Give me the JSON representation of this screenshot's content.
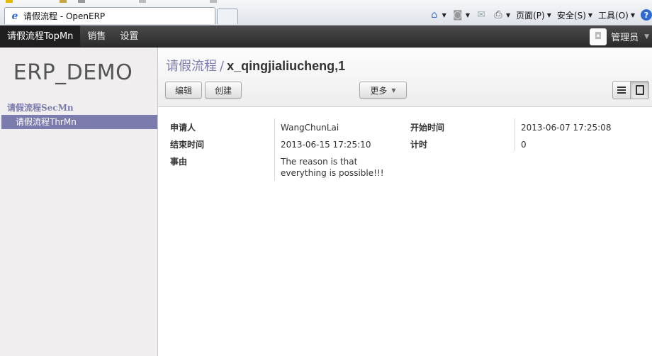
{
  "browser": {
    "tab_title": "请假流程 - OpenERP",
    "tab_icon": "ie-icon",
    "toolbar": {
      "page_label": "页面(P)",
      "safety_label": "安全(S)",
      "tools_label": "工具(O)"
    }
  },
  "topnav": {
    "menu": [
      "请假流程TopMn",
      "销售",
      "设置"
    ],
    "active_index": 0,
    "user_label": "管理员"
  },
  "sidebar": {
    "logo_text": "ERP_DEMO",
    "section_title": "请假流程SecMn",
    "items": [
      {
        "label": "请假流程ThrMn",
        "selected": true
      }
    ]
  },
  "header": {
    "breadcrumb_parent": "请假流程",
    "breadcrumb_separator": "/",
    "breadcrumb_current": "x_qingjialiucheng,1",
    "edit_label": "编辑",
    "create_label": "创建",
    "more_label": "更多"
  },
  "form": {
    "applicant_label": "申请人",
    "applicant_value": "WangChunLai",
    "start_label": "开始时间",
    "start_value": "2013-06-07 17:25:08",
    "end_label": "结束时间",
    "end_value": "2013-06-15 17:25:10",
    "duration_label": "计时",
    "duration_value": "0",
    "reason_label": "事由",
    "reason_value": "The reason is that everything is possible!!!"
  },
  "colors": {
    "accent": "#7c7bad",
    "topbar": "#2b2b2b",
    "sidebar_bg": "#f0eeee"
  }
}
